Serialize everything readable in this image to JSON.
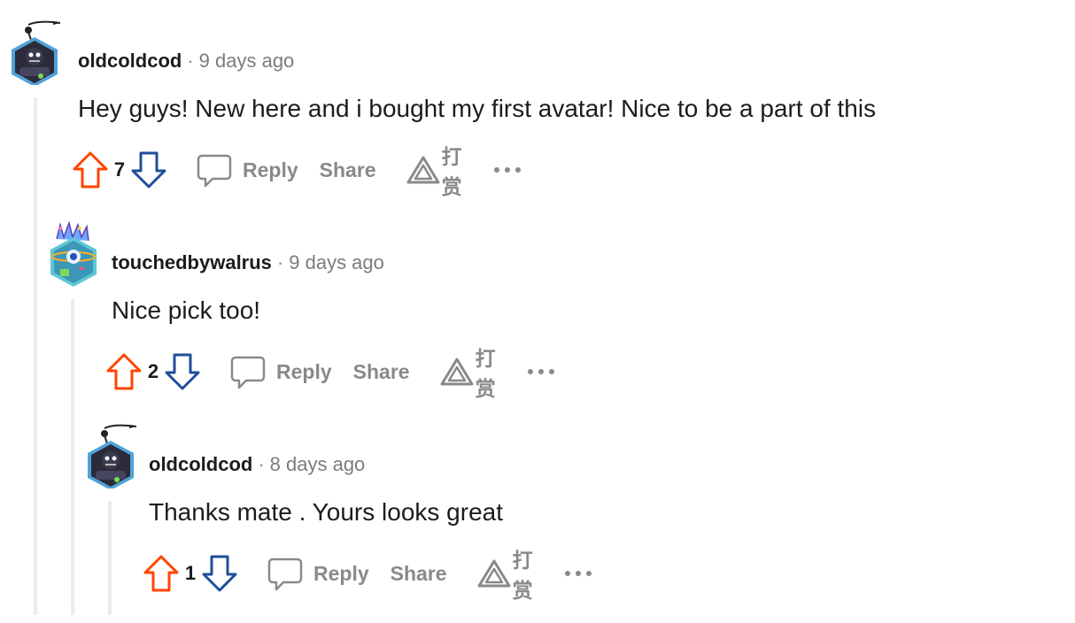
{
  "comments": [
    {
      "author": "oldcoldcod",
      "separator": "·",
      "time": "9 days ago",
      "body": "Hey guys! New here and i bought my first avatar! Nice to be a part of this",
      "score": "7",
      "reply_label": "Reply",
      "share_label": "Share",
      "award_label": "打赏",
      "more_label": "···"
    },
    {
      "author": "touchedbywalrus",
      "separator": "·",
      "time": "9 days ago",
      "body": "Nice pick too!",
      "score": "2",
      "reply_label": "Reply",
      "share_label": "Share",
      "award_label": "打赏",
      "more_label": "···"
    },
    {
      "author": "oldcoldcod",
      "separator": "·",
      "time": "8 days ago",
      "body": "Thanks mate . Yours looks great",
      "score": "1",
      "reply_label": "Reply",
      "share_label": "Share",
      "award_label": "打赏",
      "more_label": "···"
    }
  ],
  "colors": {
    "upvote": "#ff4500",
    "downvote": "#1f4e9a",
    "meta": "#878a8c",
    "thread_line": "#ececec"
  },
  "icons": {
    "upvote": "arrow-up-icon",
    "downvote": "arrow-down-icon",
    "reply": "comment-bubble-icon",
    "award": "award-triangle-icon",
    "more": "more-dots-icon"
  }
}
